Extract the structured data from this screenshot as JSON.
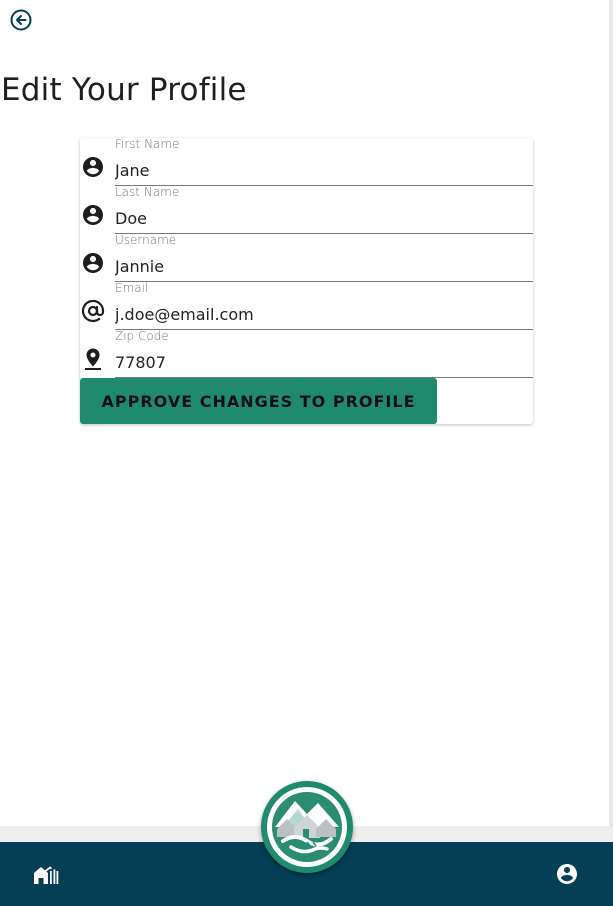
{
  "header": {
    "back_icon": "arrow-left-circle-icon"
  },
  "page": {
    "title": "Edit Your Profile"
  },
  "form": {
    "fields": [
      {
        "label": "First Name",
        "value": "Jane",
        "icon": "person-circle-icon"
      },
      {
        "label": "Last Name",
        "value": "Doe",
        "icon": "person-circle-icon"
      },
      {
        "label": "Username",
        "value": "Jannie",
        "icon": "person-circle-icon"
      },
      {
        "label": "Email",
        "value": "j.doe@email.com",
        "icon": "at-sign-icon"
      },
      {
        "label": "Zip Code",
        "value": "77807",
        "icon": "location-pin-icon"
      }
    ],
    "submit_label": "APPROVE CHANGES TO PROFILE"
  },
  "nav": {
    "home_icon": "homes-icon",
    "logo": "community-handshake-logo",
    "profile_icon": "account-circle-icon"
  },
  "colors": {
    "primary": "#1f8a6e",
    "nav_bg": "#053f55",
    "text": "#222222"
  }
}
